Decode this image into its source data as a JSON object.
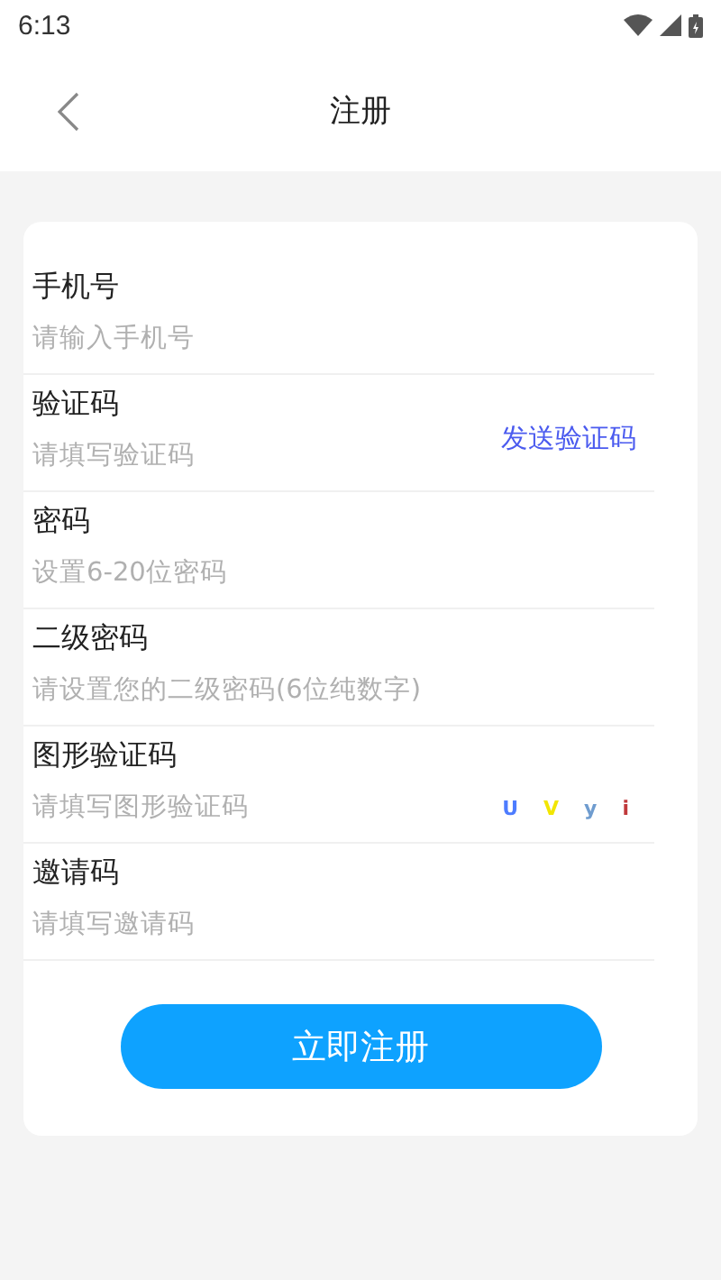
{
  "status_bar": {
    "time": "6:13"
  },
  "header": {
    "title": "注册"
  },
  "fields": [
    {
      "kind": "text",
      "label": "手机号",
      "placeholder": "请输入手机号"
    },
    {
      "kind": "sms",
      "label": "验证码",
      "placeholder": "请填写验证码",
      "action": "发送验证码"
    },
    {
      "kind": "text",
      "label": "密码",
      "placeholder": "设置6-20位密码"
    },
    {
      "kind": "text",
      "label": "二级密码",
      "placeholder": "请设置您的二级密码(6位纯数字)"
    },
    {
      "kind": "captcha",
      "label": "图形验证码",
      "placeholder": "请填写图形验证码",
      "captcha": [
        {
          "char": "U",
          "color": "#4d7cff"
        },
        {
          "char": "V",
          "color": "#f2e600"
        },
        {
          "char": "y",
          "color": "#6f9ccf"
        },
        {
          "char": "i",
          "color": "#c0393b"
        }
      ]
    },
    {
      "kind": "text",
      "label": "邀请码",
      "placeholder": "请填写邀请码"
    }
  ],
  "submit": "立即注册"
}
